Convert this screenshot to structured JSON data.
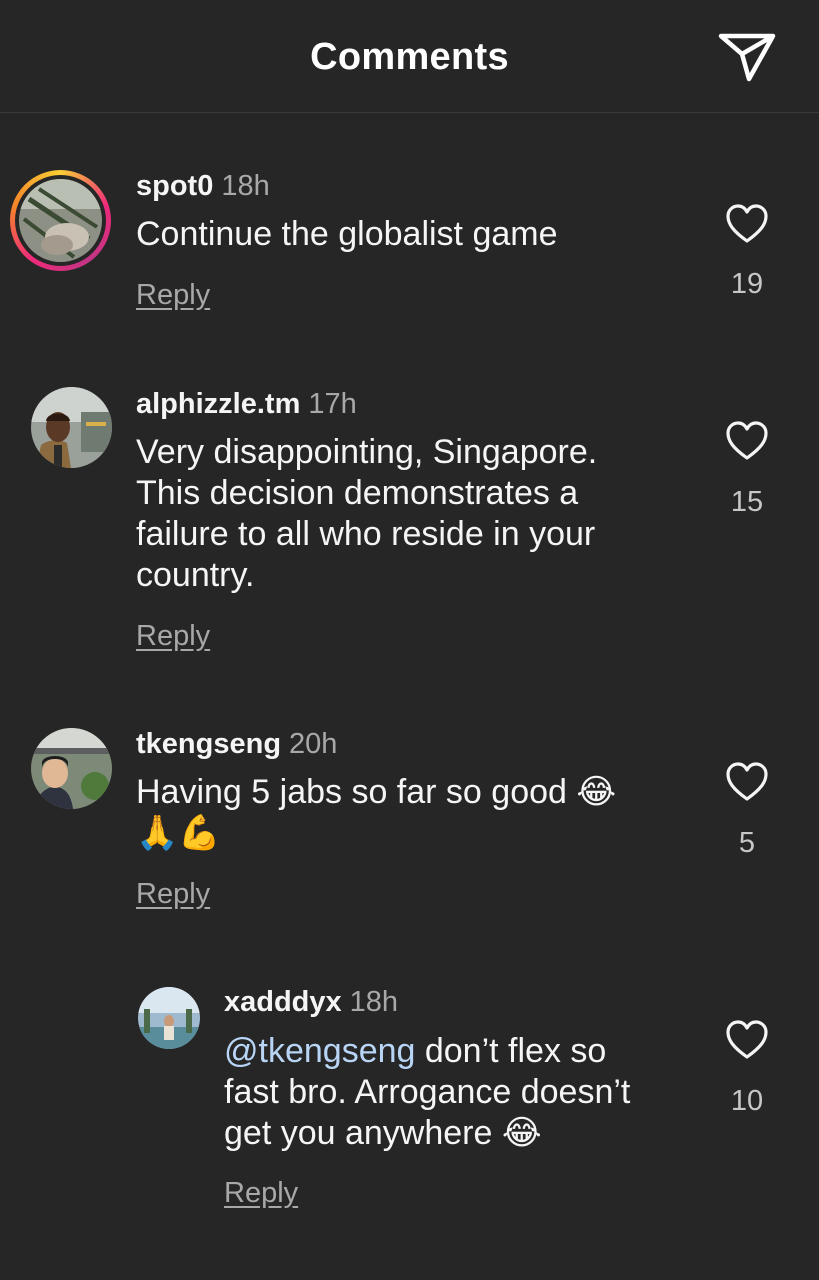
{
  "header": {
    "title": "Comments",
    "send_icon": "paper-plane-icon"
  },
  "colors": {
    "background": "#262626",
    "text": "#f5f5f5",
    "muted": "#a8a8a8",
    "mention": "#b8d5f5"
  },
  "comments": [
    {
      "username": "spot0",
      "time": "18h",
      "text": "Continue the globalist game",
      "reply_label": "Reply",
      "likes": "19",
      "has_story_ring": true
    },
    {
      "username": "alphizzle.tm",
      "time": "17h",
      "text_lines": [
        "Very disappointing, Singapore.",
        "This decision demonstrates a",
        "failure to all who reside in your",
        "country."
      ],
      "reply_label": "Reply",
      "likes": "15"
    },
    {
      "username": "tkengseng",
      "time": "20h",
      "text": "Having 5 jabs so far so good",
      "emoji_1": "😂",
      "emoji_line_2": "🙏💪",
      "reply_label": "Reply",
      "likes": "5"
    },
    {
      "username": "xadddyx",
      "time": "18h",
      "mention": "@tkengseng",
      "text_line_1": " don’t flex so",
      "text_line_2": "fast bro. Arrogance doesn’t",
      "text_line_3": "get you anywhere",
      "emoji": "😂",
      "reply_label": "Reply",
      "likes": "10",
      "is_reply": true
    }
  ]
}
